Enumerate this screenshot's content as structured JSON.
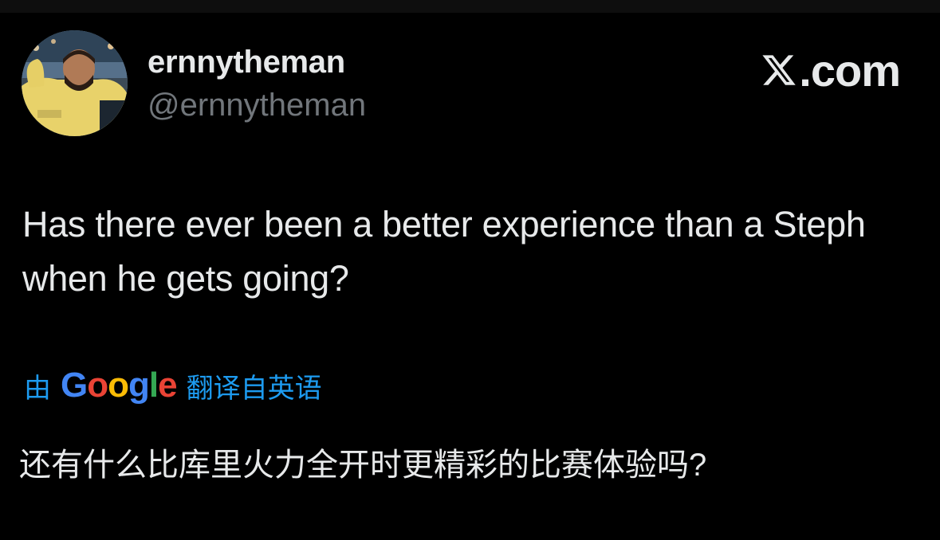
{
  "user": {
    "display_name": "ernnytheman",
    "handle": "@ernnytheman"
  },
  "brand": {
    "icon": "x-logo-icon",
    "suffix": ".com"
  },
  "tweet": {
    "text": "Has there ever been a better experience than a Steph when he gets going?"
  },
  "translation": {
    "prefix": "由",
    "google_letters": [
      "G",
      "o",
      "o",
      "g",
      "l",
      "e"
    ],
    "suffix": "翻译自英语",
    "text": "还有什么比库里火力全开时更精彩的比赛体验吗?"
  },
  "colors": {
    "background": "#000000",
    "primary_text": "#e7e9ea",
    "secondary_text": "#71767b",
    "link": "#1d9bf0",
    "google_blue": "#4285f4",
    "google_red": "#ea4335",
    "google_yellow": "#fbbc05",
    "google_green": "#34a853"
  }
}
